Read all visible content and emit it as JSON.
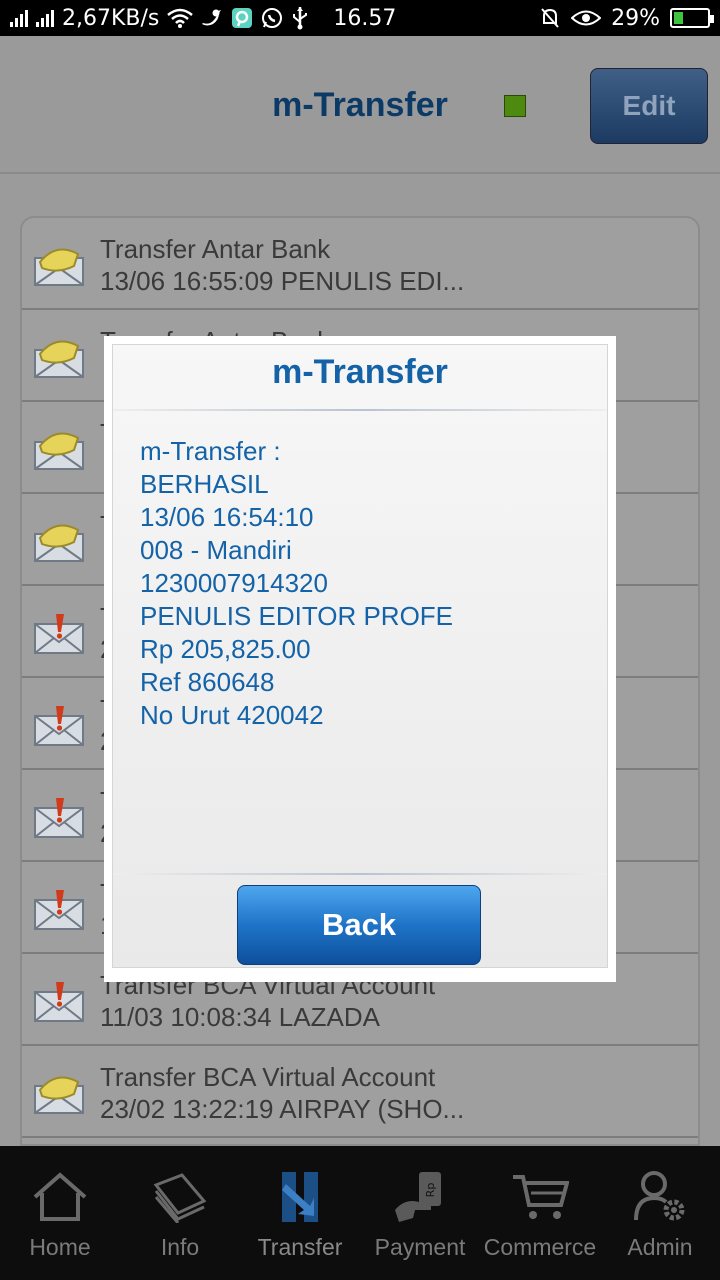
{
  "status_bar": {
    "network_speed": "2,67KB/s",
    "time": "16.57",
    "battery": "29%",
    "battery_level": 0.29
  },
  "header": {
    "title": "m-Transfer",
    "edit_label": "Edit"
  },
  "list": {
    "items": [
      {
        "line1": "Transfer Antar Bank",
        "line2": "13/06 16:55:09 PENULIS EDI...",
        "icon": "read-envelope-icon"
      },
      {
        "line1": "Transfer Antar Bank",
        "line2": "",
        "icon": "read-envelope-icon"
      },
      {
        "line1": "T",
        "line2": "",
        "icon": "read-envelope-icon"
      },
      {
        "line1": "T",
        "line2": "",
        "icon": "read-envelope-icon"
      },
      {
        "line1": "T",
        "line2": "2",
        "icon": "alert-envelope-icon"
      },
      {
        "line1": "T",
        "line2": "2",
        "icon": "alert-envelope-icon"
      },
      {
        "line1": "T",
        "line2": "2",
        "icon": "alert-envelope-icon"
      },
      {
        "line1": "T",
        "line2": "1",
        "icon": "alert-envelope-icon"
      },
      {
        "line1": "Transfer BCA Virtual Account",
        "line2": "11/03 10:08:34 LAZADA",
        "icon": "alert-envelope-icon"
      },
      {
        "line1": "Transfer BCA Virtual Account",
        "line2": "23/02 13:22:19 AIRPAY (SHO...",
        "icon": "read-envelope-icon"
      }
    ]
  },
  "dialog": {
    "title": "m-Transfer",
    "lines": [
      "m-Transfer :",
      "BERHASIL",
      "13/06 16:54:10",
      "008 - Mandiri",
      "1230007914320",
      "PENULIS EDITOR PROFE",
      "Rp 205,825.00",
      "Ref 860648",
      "No Urut 420042"
    ],
    "back_label": "Back"
  },
  "nav": {
    "items": [
      {
        "label": "Home",
        "icon": "home-icon"
      },
      {
        "label": "Info",
        "icon": "info-book-icon"
      },
      {
        "label": "Transfer",
        "icon": "transfer-icon"
      },
      {
        "label": "Payment",
        "icon": "payment-icon"
      },
      {
        "label": "Commerce",
        "icon": "cart-icon"
      },
      {
        "label": "Admin",
        "icon": "admin-gear-icon"
      }
    ]
  }
}
